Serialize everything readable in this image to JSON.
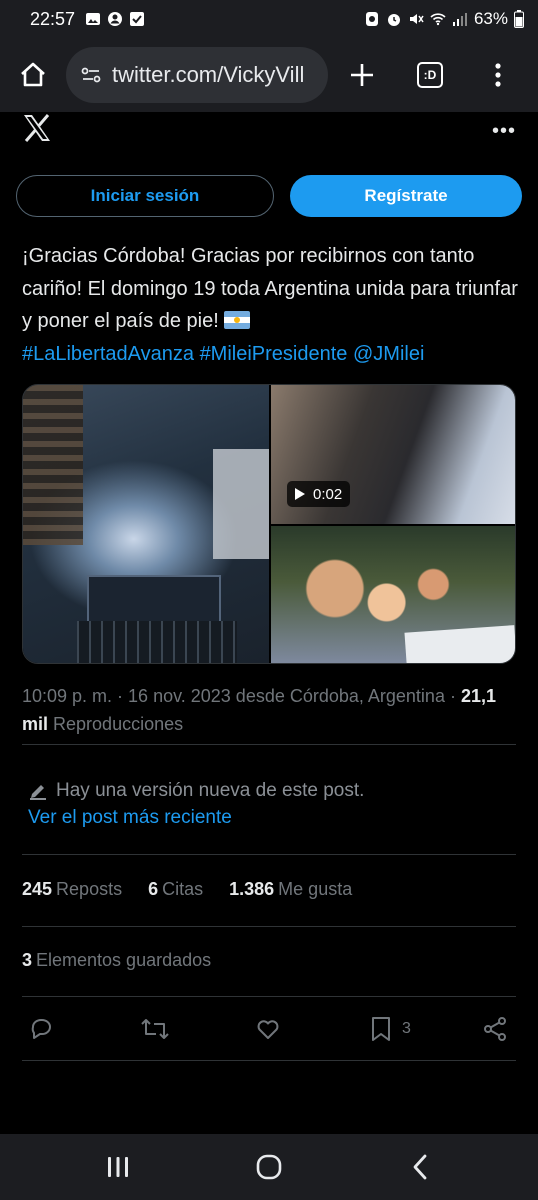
{
  "status_bar": {
    "time": "22:57",
    "battery": "63%"
  },
  "browser": {
    "url": "twitter.com/VickyVill",
    "tab_count_label": ":D"
  },
  "header": {
    "logo_icon": "x-logo-icon",
    "more_label": "•••"
  },
  "auth": {
    "login_label": "Iniciar sesión",
    "register_label": "Regístrate"
  },
  "tweet": {
    "text": "¡Gracias Córdoba! Gracias por recibirnos con tanto cariño! El domingo 19 toda Argentina unida para triunfar y poner el país de pie!",
    "hashtag1": "#LaLibertadAvanza",
    "hashtag2": "#MileiPresidente",
    "mention": "@JMilei",
    "video_duration": "0:02"
  },
  "meta": {
    "datetime": "10:09 p. m. · 16 nov. 2023 desde Córdoba, Argentina",
    "views_count": "21,1 mil",
    "views_label": "Reproducciones"
  },
  "notice": {
    "text": "Hay una versión nueva de este post.",
    "link": "Ver el post más reciente"
  },
  "stats": {
    "reposts_count": "245",
    "reposts_label": "Reposts",
    "quotes_count": "6",
    "quotes_label": "Citas",
    "likes_count": "1.386",
    "likes_label": "Me gusta",
    "saved_count": "3",
    "saved_label": "Elementos guardados"
  },
  "actions": {
    "bookmark_count": "3"
  },
  "colors": {
    "accent": "#1d9bf0",
    "background": "#000000",
    "chrome": "#1c1d21",
    "muted": "#71767b"
  }
}
